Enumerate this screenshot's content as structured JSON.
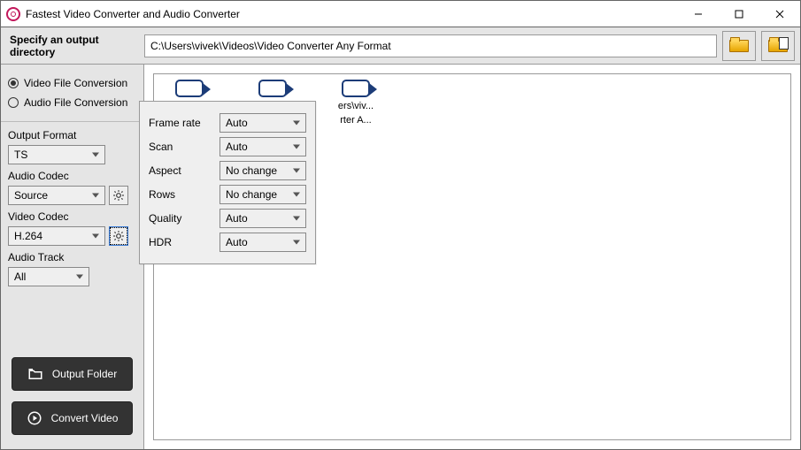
{
  "titlebar": {
    "title": "Fastest Video Converter and Audio Converter"
  },
  "dirRow": {
    "label": "Specify an output directory",
    "path": "C:\\Users\\vivek\\Videos\\Video Converter Any Format"
  },
  "sidebar": {
    "radios": [
      "Video File Conversion",
      "Audio File Conversion"
    ],
    "outputFormat": {
      "label": "Output Format",
      "value": "TS"
    },
    "audioCodec": {
      "label": "Audio Codec",
      "value": "Source"
    },
    "videoCodec": {
      "label": "Video Codec",
      "value": "H.264"
    },
    "audioTrack": {
      "label": "Audio Track",
      "value": "All"
    },
    "buttons": {
      "outputFolder": "Output Folder",
      "convertVideo": "Convert Video"
    }
  },
  "main": {
    "files": [
      {
        "line1": "",
        "line2": ""
      },
      {
        "line1": "",
        "line2": ""
      },
      {
        "line1": "ers\\viv...",
        "line2": "rter A..."
      }
    ]
  },
  "popup": {
    "rows": [
      {
        "label": "Frame rate",
        "value": "Auto"
      },
      {
        "label": "Scan",
        "value": "Auto"
      },
      {
        "label": "Aspect",
        "value": "No change"
      },
      {
        "label": "Rows",
        "value": "No change"
      },
      {
        "label": "Quality",
        "value": "Auto"
      },
      {
        "label": "HDR",
        "value": "Auto"
      }
    ]
  }
}
